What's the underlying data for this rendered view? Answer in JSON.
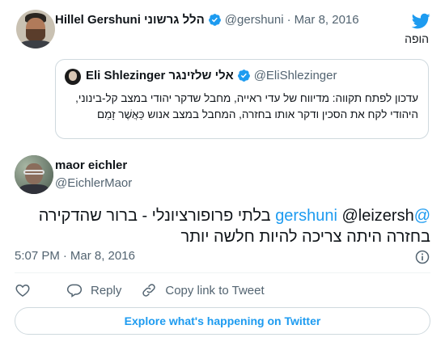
{
  "parent": {
    "display_name": "Hillel Gershuni הלל גרשוני",
    "handle": "@gershuni",
    "separator": "·",
    "date": "Mar 8, 2016",
    "text": "הופה",
    "quoted": {
      "display_name": "Eli Shlezinger אלי שלזינגר",
      "handle": "@EliShlezinger",
      "text": "עדכון לפתח תקווה: מדיווח של עדי ראייה, מחבל שדקר יהודי במצב קל-בינוני, היהודי לקח את הסכין ודקר אותו בחזרה, המחבל במצב אנוש כַּאֲשֶׁר זָמַם"
    }
  },
  "tweet": {
    "display_name": "maor eichler",
    "handle": "@EichlerMaor",
    "mention_1": "@gershuni",
    "mention_2": "@leizersh",
    "text": "בלתי פרופורציונלי - ברור שהדקירה בחזרה היתה צריכה להיות חלשה יותר",
    "time": "5:07 PM",
    "separator": "·",
    "date": "Mar 8, 2016"
  },
  "actions": {
    "like_icon": "heart-icon",
    "reply_label": "Reply",
    "copy_link_label": "Copy link to Tweet"
  },
  "explore_label": "Explore what's happening on Twitter",
  "colors": {
    "accent": "#1d9bf0",
    "verified": "#1d9bf0",
    "muted_text": "#536471",
    "border": "#cfd9de"
  }
}
